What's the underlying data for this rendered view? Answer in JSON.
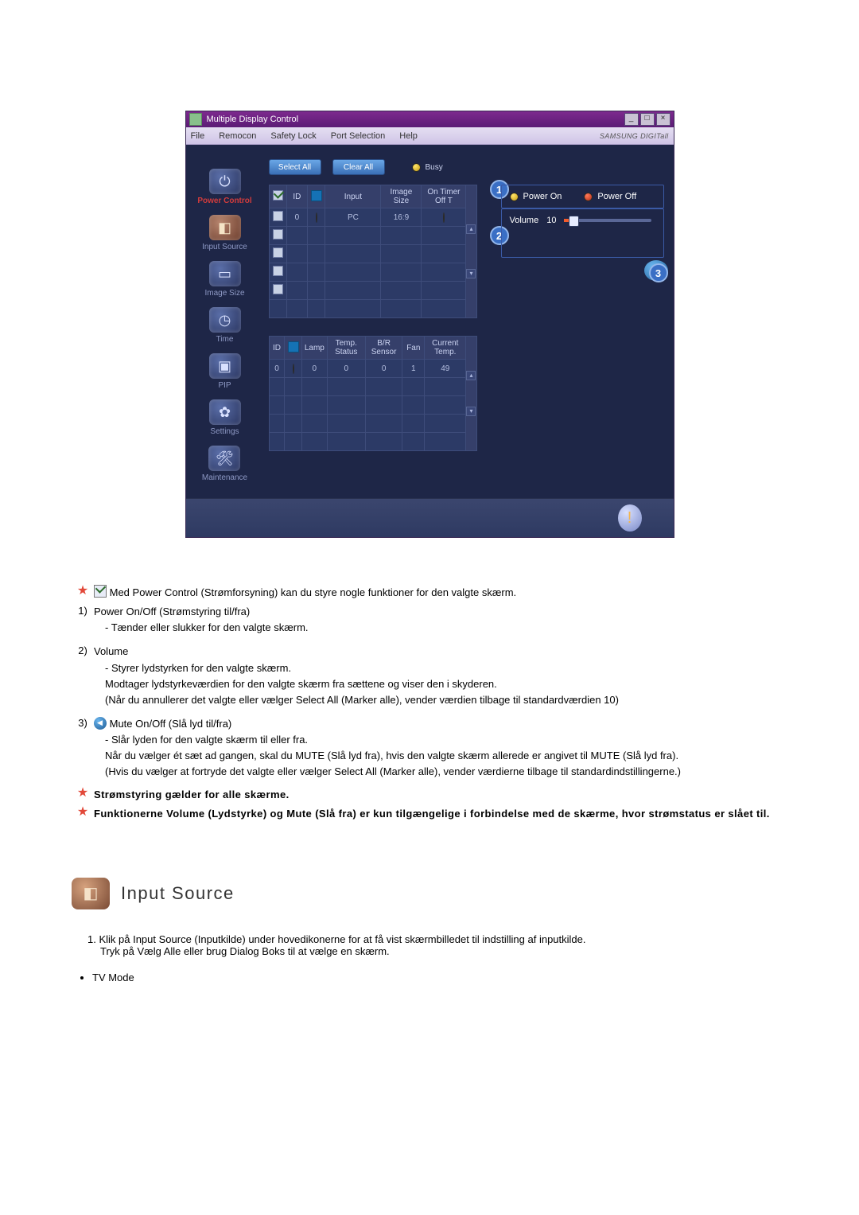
{
  "app": {
    "title": "Multiple Display Control",
    "menu": {
      "file": "File",
      "remocon": "Remocon",
      "safety_lock": "Safety Lock",
      "port_selection": "Port Selection",
      "help": "Help"
    },
    "brand": "SAMSUNG DIGITall"
  },
  "sidebar": {
    "power_control": "Power Control",
    "input_source": "Input Source",
    "image_size": "Image Size",
    "time": "Time",
    "pip": "PIP",
    "settings": "Settings",
    "maintenance": "Maintenance"
  },
  "toolbar": {
    "select_all": "Select All",
    "clear_all": "Clear All",
    "busy": "Busy"
  },
  "table1": {
    "headers": {
      "chk": "",
      "id": "ID",
      "pwr": "",
      "input": "Input",
      "image_size": "Image Size",
      "on_timer": "On Timer Off T"
    },
    "row": {
      "id": "0",
      "input": "PC",
      "image_size": "16:9"
    }
  },
  "table2": {
    "headers": {
      "id": "ID",
      "pwr": "",
      "lamp": "Lamp",
      "temp_status": "Temp. Status",
      "br_sensor": "B/R Sensor",
      "fan": "Fan",
      "current_temp": "Current Temp."
    },
    "row": {
      "id": "0",
      "lamp": "0",
      "temp_status": "0",
      "br_sensor": "0",
      "fan": "1",
      "current_temp": "49"
    }
  },
  "controls": {
    "power_on": "Power On",
    "power_off": "Power Off",
    "volume_label": "Volume",
    "volume_value": "10"
  },
  "callouts": {
    "c1": "1",
    "c2": "2",
    "c3": "3"
  },
  "doc": {
    "star1": "Med Power Control (Strømforsyning) kan du styre nogle funktioner for den valgte skærm.",
    "item1_title": "Power On/Off (Strømstyring til/fra)",
    "item1_a": "- Tænder eller slukker for den valgte skærm.",
    "item2_title": "Volume",
    "item2_a": "- Styrer lydstyrken for den valgte skærm.",
    "item2_b": "Modtager lydstyrkeværdien for den valgte skærm fra sættene og viser den i skyderen.",
    "item2_c": "(Når du annullerer det valgte eller vælger Select All (Marker alle), vender værdien tilbage til standardværdien 10)",
    "item3_title": "Mute On/Off (Slå lyd til/fra)",
    "item3_a": "- Slår lyden for den valgte skærm til eller fra.",
    "item3_b": "Når du vælger ét sæt ad gangen, skal du MUTE (Slå lyd fra), hvis den valgte skærm allerede er angivet til MUTE (Slå lyd fra).",
    "item3_c": "(Hvis du vælger at fortryde det valgte eller vælger Select All (Marker alle), vender værdierne tilbage til standardindstillingerne.)",
    "star2": "Strømstyring gælder for alle skærme.",
    "star3": "Funktionerne Volume (Lydstyrke) og Mute (Slå fra) er kun tilgængelige i forbindelse med de skærme, hvor strømstatus er slået til.",
    "num1": "1)",
    "num2": "2)",
    "num3": "3)"
  },
  "insrc": {
    "heading": "Input Source",
    "p1": "1.  Klik på Input Source (Inputkilde) under hovedikonerne for at få vist skærmbilledet til indstilling af inputkilde.",
    "p1b": "Tryk på Vælg Alle eller brug Dialog Boks til at vælge en skærm.",
    "bullet1": "TV Mode"
  }
}
